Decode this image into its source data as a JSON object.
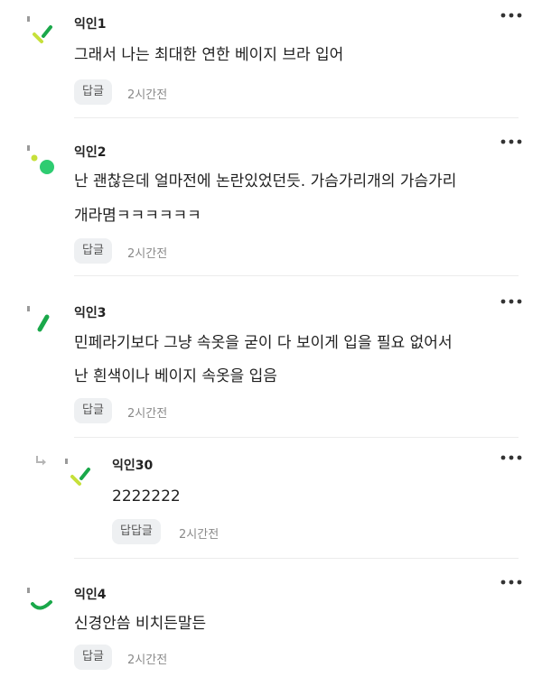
{
  "comments": [
    {
      "author": "익인1",
      "lines": [
        "그래서 나는 최대한 연한 베이지 브라 입어"
      ],
      "reply_label": "답글",
      "time": "2시간전",
      "avatar_icon": "abstract-green-sticks-icon"
    },
    {
      "author": "익인2",
      "lines": [
        "난 괜찮은데 얼마전에 논란있었던듯. 가슴가리개의 가슴가리",
        "개라몀ㅋㅋㅋㅋㅋㅋ"
      ],
      "reply_label": "답글",
      "time": "2시간전",
      "avatar_icon": "abstract-green-circles-icon"
    },
    {
      "author": "익인3",
      "lines": [
        "민페라기보다 그냥 속옷을 굳이 다 보이게 입을 필요 없어서",
        "난 흰색이나 베이지 속옷을 입음"
      ],
      "reply_label": "답글",
      "time": "2시간전",
      "avatar_icon": "abstract-green-bar-icon"
    },
    {
      "author": "익인30",
      "lines": [
        "2222222"
      ],
      "reply_label": "답답글",
      "time": "2시간전",
      "avatar_icon": "abstract-green-sticks-icon"
    },
    {
      "author": "익인4",
      "lines": [
        "신경안씀 비치든말든"
      ],
      "reply_label": "답글",
      "time": "2시간전",
      "avatar_icon": "abstract-green-arc-icon"
    }
  ],
  "colors": {
    "avatar_green": "#2ecc71",
    "avatar_lime": "#c6e03a",
    "avatar_dark_green": "#1aa84a",
    "reply_bg": "#eef0f2"
  }
}
